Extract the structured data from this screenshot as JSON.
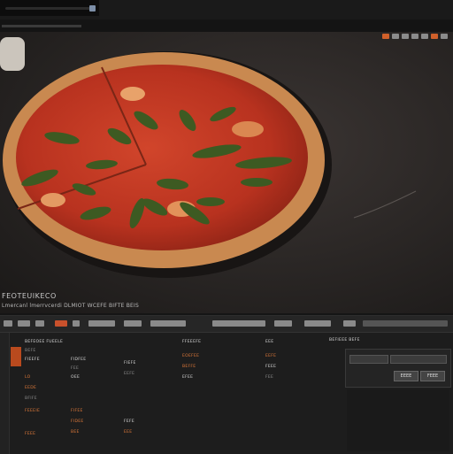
{
  "viewer": {
    "caption_line1": "FEOTEUIKECO",
    "caption_line2": "Lmercanl lmerrvcerdi DLMIOT WCEFE BIFTE BEIS"
  },
  "panel": {
    "rows": [
      {
        "a": "BEFEOEE FUEELE",
        "b": "FIDFEE"
      },
      {
        "a": "BEFE",
        "b": "FEE"
      },
      {
        "a": "FIEEFE",
        "b": "OEE"
      },
      {
        "a": "LO",
        "b": "FIFEE"
      },
      {
        "a": "EEDE",
        "b": "FIDEE"
      },
      {
        "a": "BFIFE",
        "b": "BEE"
      },
      {
        "a": "FEEEIE",
        "b": "FEOIE"
      },
      {
        "a": "FEEE",
        "b": "FEE"
      }
    ],
    "col3": [
      "FIEFE",
      "EEFE",
      "FEFE",
      "EEE"
    ],
    "col4": [
      "FFEEEFE",
      "EOEFEE",
      "BEFFE",
      "EFEE"
    ],
    "col5": [
      "EEE",
      "EEFE",
      "FEEE",
      "FEE"
    ],
    "header_right": "BEFIEEE BEFE",
    "rpanel_buttons": [
      "EEEE",
      "FEEE"
    ]
  },
  "colors": {
    "accent": "#d0602a",
    "panel_bg": "#1d1d1d",
    "table_surface": "#2a2624"
  }
}
